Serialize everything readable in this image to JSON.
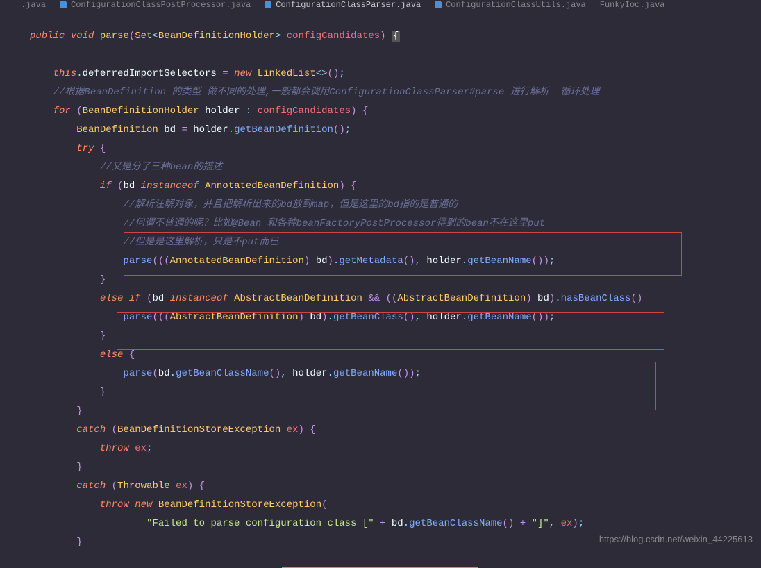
{
  "tabs": {
    "t0": ".java",
    "t1": "ConfigurationClassPostProcessor.java",
    "t2": "ConfigurationClassParser.java",
    "t3": "ConfigurationClassUtils.java",
    "t4": "FunkyIoc.java"
  },
  "code": {
    "public": "public",
    "void": "void",
    "parse": "parse",
    "set": "Set",
    "bdh": "BeanDefinitionHolder",
    "configCandidates": "configCandidates",
    "lbrace": "{",
    "rbrace": "}",
    "this": "this",
    "deferred": "deferredImportSelectors",
    "new": "new",
    "linkedlist": "LinkedList",
    "diamond": "<>",
    "lparen": "(",
    "rparen": ")",
    "semi": ";",
    "eq": "=",
    "comment1_a": "//根据",
    "comment1_b": "BeanDefinition",
    "comment1_c": " 的类型 做不同的处理,一般都会调用",
    "comment1_d": "ConfigurationClassParser#parse",
    "comment1_e": " 进行解析  循环处理",
    "for": "for",
    "holder": "holder",
    "colon": ":",
    "bd": "bd",
    "beandef": "BeanDefinition",
    "getbeandef": "getBeanDefinition",
    "try": "try",
    "comment2_a": "//又是分了三种",
    "comment2_b": "bean",
    "comment2_c": "的描述",
    "if": "if",
    "instanceof": "instanceof",
    "annotbd": "AnnotatedBeanDefinition",
    "comment3_a": "//解析注解对象，并且把解析出来的",
    "comment3_b": "bd",
    "comment3_c": "放到",
    "comment3_d": "map",
    "comment3_e": "，但是这里的",
    "comment3_f": "bd",
    "comment3_g": "指的是普通的",
    "comment4_a": "//何谓不普通的呢？比如",
    "comment4_b": "@Bean",
    "comment4_c": " 和各种",
    "comment4_d": "beanFactoryPostProcessor",
    "comment4_e": "得到的",
    "comment4_f": "bean",
    "comment4_g": "不在这里",
    "comment4_h": "put",
    "comment5_a": "//但是是这里解析，只是不",
    "comment5_b": "put",
    "comment5_c": "而已",
    "getmetadata": "getMetadata",
    "getbeanname": "getBeanName",
    "comma": ",",
    "else": "else",
    "abstractbd": "AbstractBeanDefinition",
    "and": "&&",
    "hasbeanclass": "hasBeanClass",
    "getbeanclass": "getBeanClass",
    "getbeanclassname": "getBeanClassName",
    "catch": "catch",
    "bdse": "BeanDefinitionStoreException",
    "ex": "ex",
    "throw": "throw",
    "throwable": "Throwable",
    "failed": "\"Failed to parse configuration class [\"",
    "plus": "+",
    "closebr": "\"]\""
  },
  "watermark": "https://blog.csdn.net/weixin_44225613"
}
